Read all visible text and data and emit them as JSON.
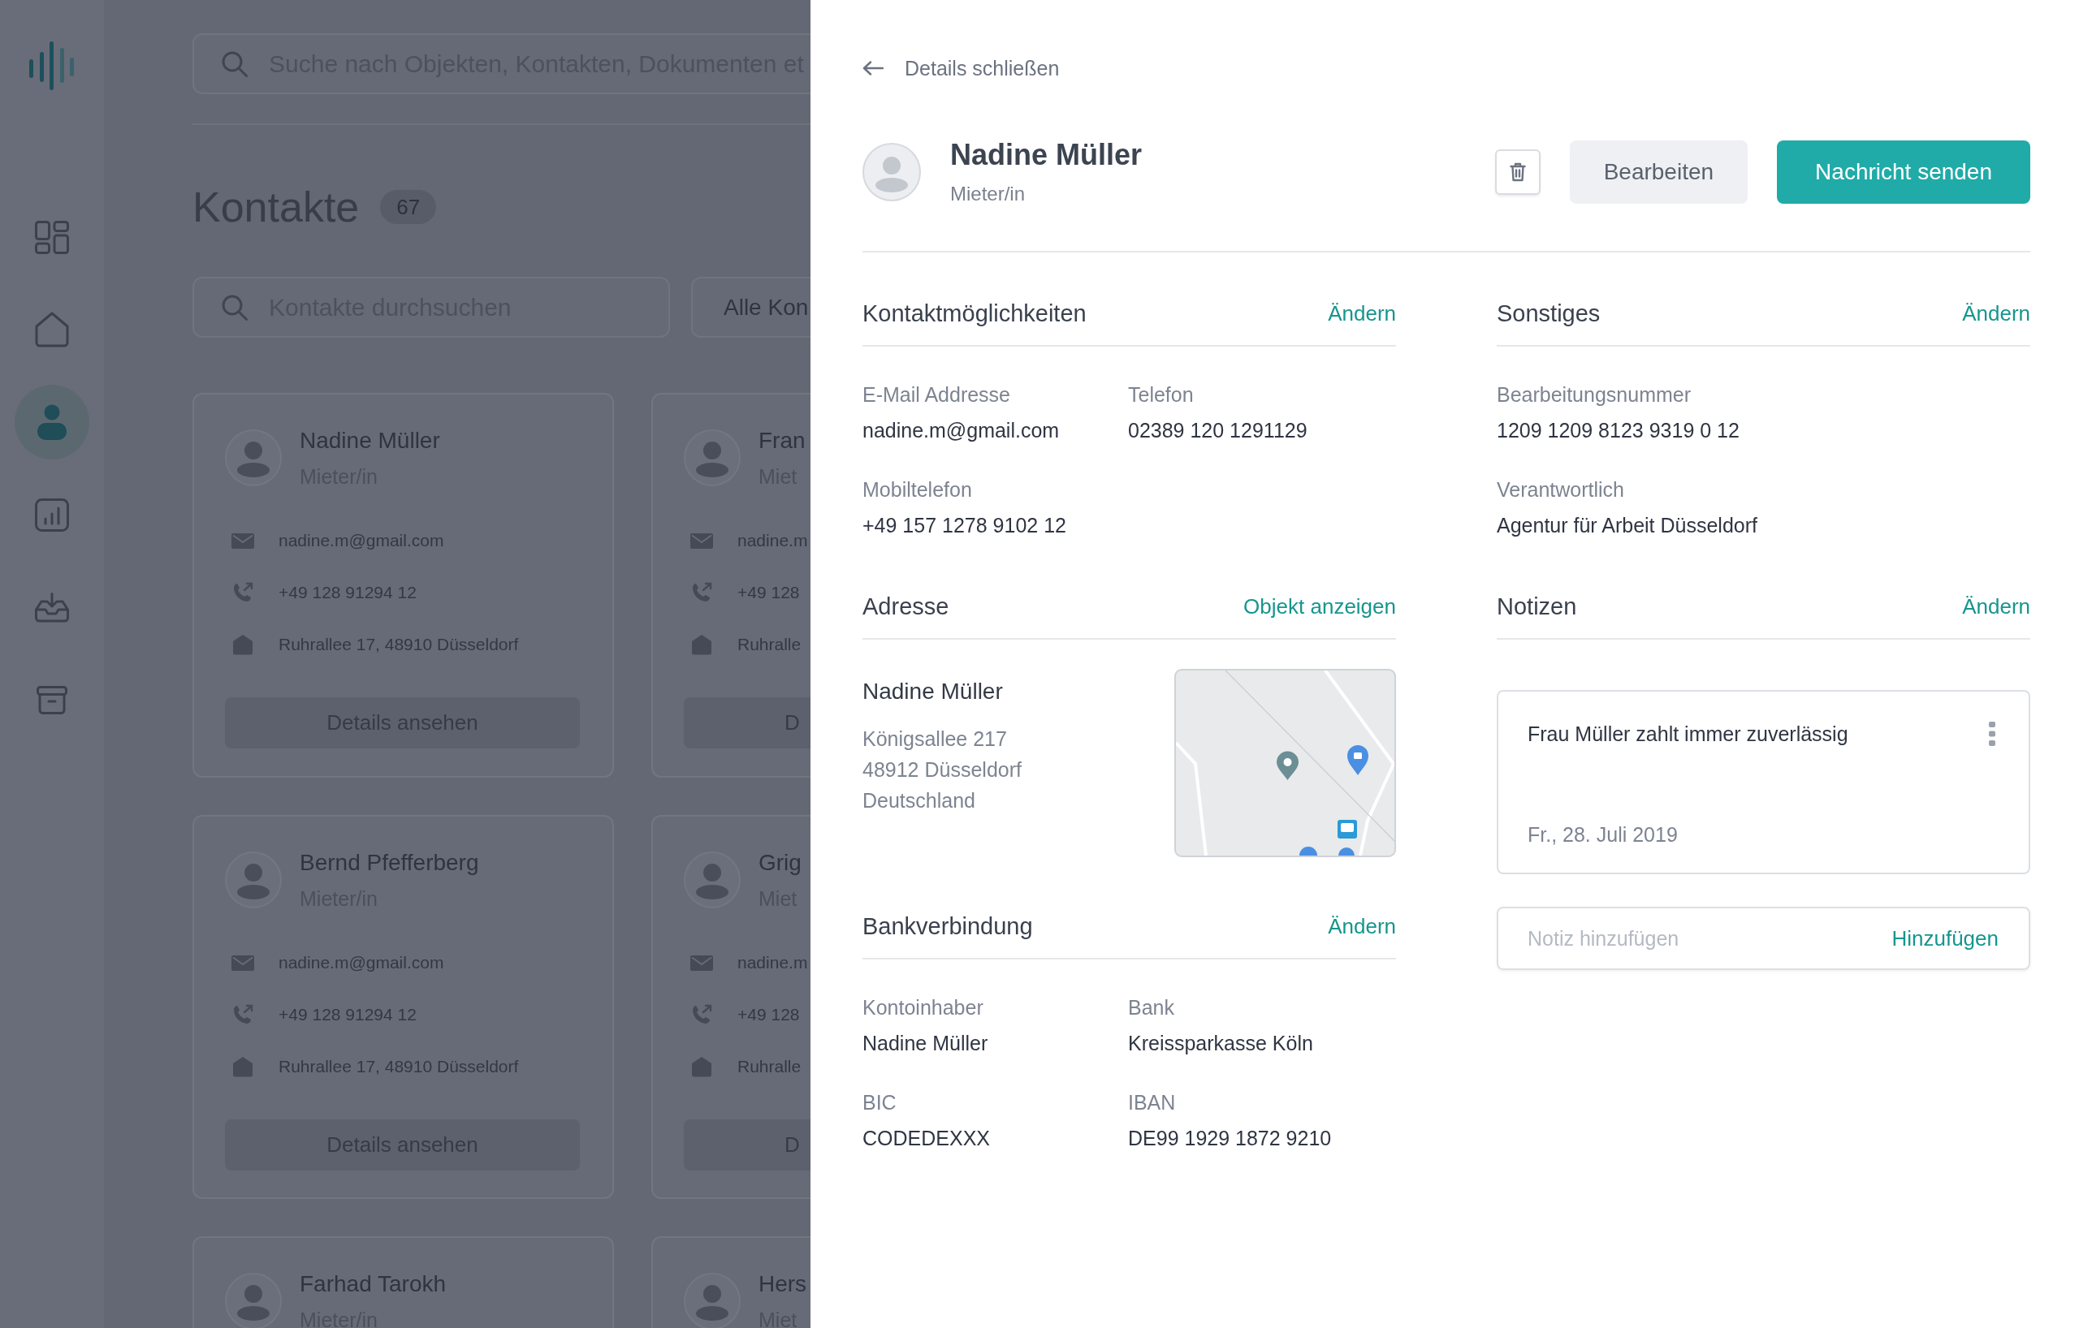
{
  "sidebar": {
    "items": [
      {
        "kind": "dashboard",
        "selected": false
      },
      {
        "kind": "home",
        "selected": false
      },
      {
        "kind": "contacts",
        "selected": true
      },
      {
        "kind": "statistics",
        "selected": false
      },
      {
        "kind": "inbox",
        "selected": false
      },
      {
        "kind": "archive",
        "selected": false
      }
    ]
  },
  "search": {
    "placeholder": "Suche nach Objekten, Kontakten, Dokumenten et"
  },
  "page": {
    "title": "Kontakte",
    "count": "67"
  },
  "contact_search": {
    "placeholder": "Kontakte durchsuchen"
  },
  "filter": {
    "label": "Alle Kon"
  },
  "cards": [
    {
      "name": "Nadine Müller",
      "role": "Mieter/in",
      "email": "nadine.m@gmail.com",
      "phone": "+49 128 91294 12",
      "address": "Ruhrallee 17, 48910 Düsseldorf",
      "button": "Details ansehen"
    },
    {
      "name": "Fran",
      "role": "Miet",
      "email": "nadine.m",
      "phone": "+49 128",
      "address": "Ruhralle",
      "button": "D"
    },
    {
      "name": "Bernd Pfefferberg",
      "role": "Mieter/in",
      "email": "nadine.m@gmail.com",
      "phone": "+49 128 91294 12",
      "address": "Ruhrallee 17, 48910 Düsseldorf",
      "button": "Details ansehen"
    },
    {
      "name": "Grig",
      "role": "Miet",
      "email": "nadine.m",
      "phone": "+49 128",
      "address": "Ruhralle",
      "button": "D"
    },
    {
      "name": "Farhad Tarokh",
      "role": "Mieter/in"
    },
    {
      "name": "Hers",
      "role": "Miet"
    }
  ],
  "details": {
    "close": "Details schließen",
    "name": "Nadine Müller",
    "role": "Mieter/in",
    "actions": [
      {
        "kind": "delete"
      },
      {
        "kind": "secondary",
        "label": "Bearbeiten"
      },
      {
        "kind": "primary",
        "label": "Nachricht senden"
      }
    ],
    "columns": [
      {
        "sections": [
          {
            "kind": "fields",
            "title": "Kontaktmöglichkeiten",
            "action": "Ändern",
            "rows": [
              [
                {
                  "label": "E-Mail Addresse",
                  "value": "nadine.m@gmail.com"
                },
                {
                  "label": "Telefon",
                  "value": "02389 120 1291129"
                }
              ],
              [
                {
                  "label": "Mobiltelefon",
                  "value": "+49 157 1278 9102 12"
                }
              ]
            ]
          },
          {
            "kind": "address",
            "title": "Adresse",
            "action": "Objekt anzeigen",
            "name": "Nadine Müller",
            "lines": [
              "Königsallee 217",
              "48912 Düsseldorf",
              "Deutschland"
            ]
          },
          {
            "kind": "fields",
            "title": "Bankverbindung",
            "action": "Ändern",
            "rows": [
              [
                {
                  "label": "Kontoinhaber",
                  "value": "Nadine Müller"
                },
                {
                  "label": "Bank",
                  "value": "Kreissparkasse Köln"
                }
              ],
              [
                {
                  "label": "BIC",
                  "value": "CODEDEXXX"
                },
                {
                  "label": "IBAN",
                  "value": "DE99 1929 1872 9210"
                }
              ]
            ]
          }
        ]
      },
      {
        "sections": [
          {
            "kind": "fields",
            "title": "Sonstiges",
            "action": "Ändern",
            "rows": [
              [
                {
                  "label": "Bearbeitungsnummer",
                  "value": "1209 1209 8123 9319 0 12"
                }
              ],
              [
                {
                  "label": "Verantwortlich",
                  "value": "Agentur für Arbeit Düsseldorf"
                }
              ]
            ]
          },
          {
            "kind": "notes",
            "title": "Notizen",
            "action": "Ändern",
            "notes": [
              {
                "text": "Frau Müller zahlt immer zuverlässig",
                "date": "Fr., 28. Juli 2019"
              }
            ],
            "input": {
              "placeholder": "Notiz hinzufügen",
              "button": "Hinzufügen"
            }
          }
        ]
      }
    ]
  }
}
